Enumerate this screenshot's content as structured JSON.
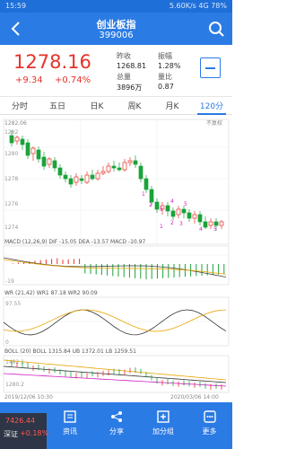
{
  "statusbar": {
    "time": "15:59",
    "right": "5.60K/s  4G  78%"
  },
  "header": {
    "title": "创业板指",
    "code": "399006"
  },
  "quote": {
    "price": "1278.16",
    "change": "+9.34",
    "change_pct": "+0.74%",
    "stats": [
      {
        "label": "昨收",
        "value": "1268.81"
      },
      {
        "label": "振幅",
        "value": "1.28%"
      },
      {
        "label": "总量",
        "value": "3896万"
      },
      {
        "label": "量比",
        "value": "0.87"
      }
    ]
  },
  "tabs": [
    "分时",
    "五日",
    "日K",
    "周K",
    "月K",
    "120分"
  ],
  "chart": {
    "label_top": "1282.06",
    "label_right_tag": "不复权",
    "ticks_main": [
      "1282",
      "1280",
      "1278",
      "1276",
      "1274"
    ],
    "wave_labels": [
      "1",
      "2",
      "3",
      "4",
      "5",
      "1",
      "2",
      "3",
      "4",
      "5"
    ],
    "macd_legend": "MACD (12,26,9)  DIF -15.05  DEA -13.57  MACD -10.97",
    "macd_tick": "-19",
    "wr_legend": "WR (21,42)  WR1 87.18  WR2 90.09",
    "wr_ticks": [
      "97.55",
      "0"
    ],
    "boll_legend": "BOLL (20)  BOLL 1315.84  UB 1372.01  LB 1259.51",
    "boll_ticks": [
      "1482.1",
      "1280.2"
    ],
    "date_left": "2019/12/06 10:30",
    "date_right": "2020/03/06 14:00"
  },
  "nav": [
    {
      "label": "资讯",
      "icon": "news-icon"
    },
    {
      "label": "分享",
      "icon": "share-icon"
    },
    {
      "label": "加分组",
      "icon": "add-group-icon"
    },
    {
      "label": "更多",
      "icon": "more-icon"
    }
  ],
  "index_box": {
    "price": "7426.44",
    "name": "深证",
    "pct": "+0.18%"
  },
  "colors": {
    "brand": "#2b7be4",
    "up": "#e5332a",
    "down": "#1aa33a",
    "dif": "#444444",
    "dea": "#e8a400"
  }
}
